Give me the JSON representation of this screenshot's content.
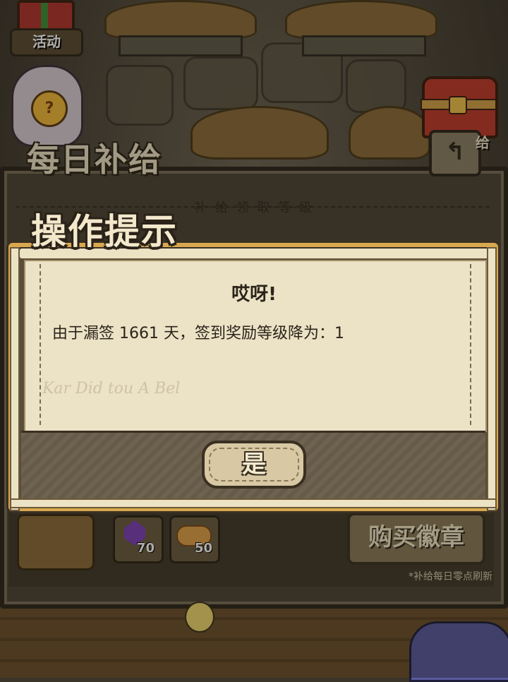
{
  "hud": {
    "activity_label": "活动",
    "supply_side_label": "给"
  },
  "daily_supply": {
    "title": "每日补给",
    "subtitle": "补·给·领·取·等·级",
    "items": [
      {
        "icon": "purple-gem-icon",
        "count": "70"
      },
      {
        "icon": "bread-icon",
        "count": "50"
      }
    ],
    "buy_badge_label": "购买徽章",
    "refresh_note": "*补给每日零点刷新"
  },
  "dialog": {
    "title": "操作提示",
    "heading": "哎呀!",
    "message": "由于漏签 1661 天，签到奖励等级降为：1",
    "confirm_label": "是"
  },
  "colors": {
    "dialog_border": "#d9a84e",
    "paper": "#ece2c6",
    "text_dark": "#2b241b"
  }
}
